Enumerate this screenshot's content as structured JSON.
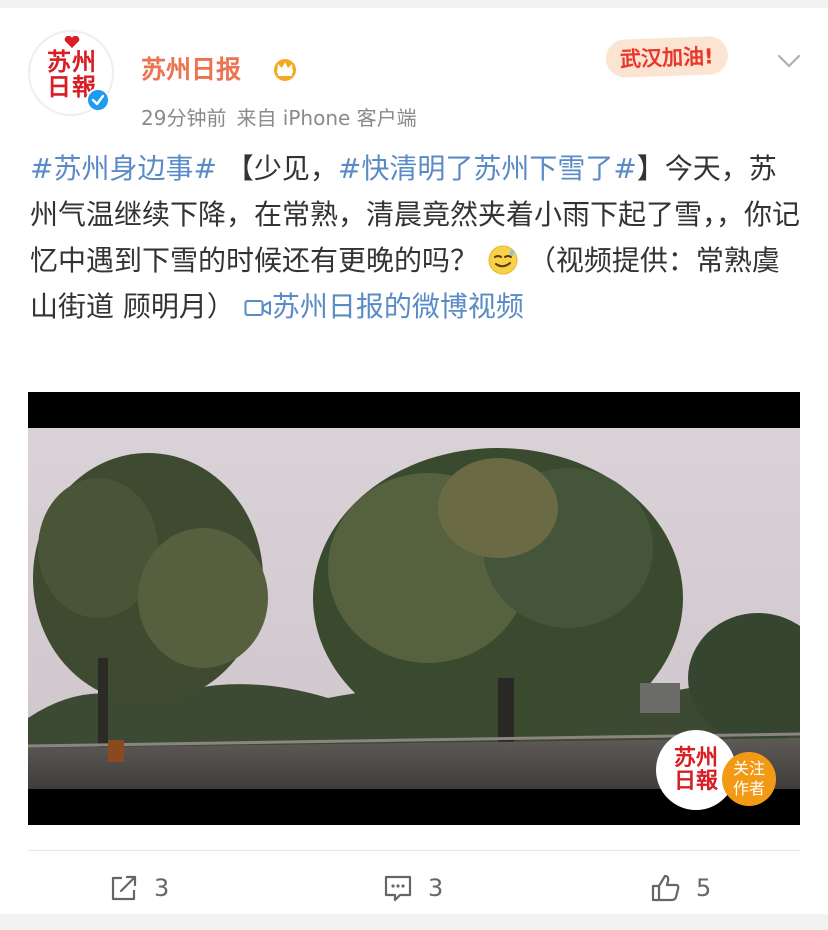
{
  "author": {
    "name": "苏州日报",
    "avatar_text": [
      "苏州",
      "日報"
    ],
    "time": "29分钟前",
    "source": "来自 iPhone 客户端"
  },
  "badge": {
    "text": "武汉加油!"
  },
  "post": {
    "tag1": "#苏州身边事#",
    "bracket_open": "【少见，",
    "tag2": "#快清明了苏州下雪了#",
    "body": "】今天，苏州气温继续下降，在常熟，清晨竟然夹着小雨下起了雪，，你记忆中遇到下雪的时候还有更晚的吗？",
    "credit": "（视频提供：常熟虞山街道 顾明月）",
    "video_link": "苏州日报的微博视频"
  },
  "video": {
    "logo_text": [
      "苏州",
      "日報"
    ],
    "follow_label": [
      "关注",
      "作者"
    ]
  },
  "actions": {
    "repost_count": "3",
    "comment_count": "3",
    "like_count": "5"
  },
  "colors": {
    "author": "#eb7350",
    "link": "#5b8bc6",
    "brand_red": "#d81e24",
    "follow_orange": "#f29a16"
  }
}
